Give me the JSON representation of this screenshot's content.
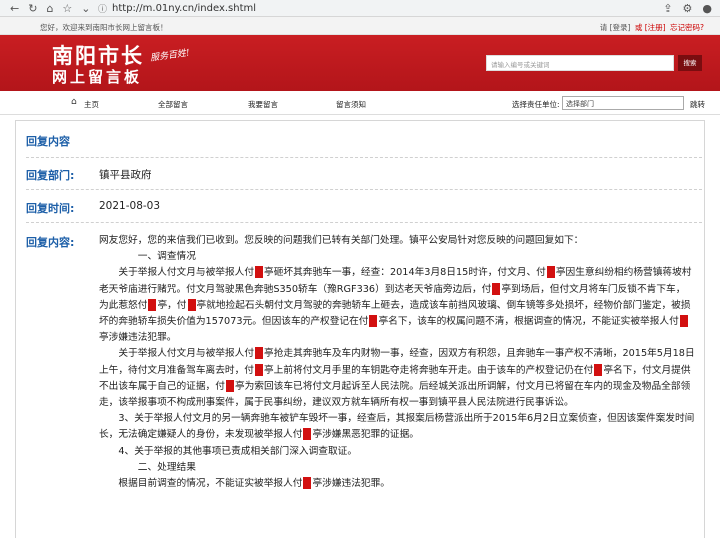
{
  "browser": {
    "url": "http://m.01ny.cn/index.shtml"
  },
  "topbar": {
    "welcome": "您好，欢迎来到南阳市长网上留言板！",
    "login": "请 [登录]",
    "register": "或 [注册]",
    "forgot": "忘记密码?"
  },
  "header": {
    "title": "南阳市长",
    "subtitle": "网上留言板",
    "slogan": "服务百姓!",
    "search_placeholder": "请输入编号或关键词",
    "search_button": "搜索"
  },
  "nav": {
    "items": [
      "主页",
      "全部留言",
      "我要留言",
      "留言须知"
    ],
    "department_label": "选择责任单位:",
    "department_selected": "选择部门",
    "jump": "跳转"
  },
  "reply": {
    "section_title": "回复内容",
    "dept_label": "回复部门:",
    "dept_value": "镇平县政府",
    "time_label": "回复时间:",
    "time_value": "2021-08-03",
    "content_label": "回复内容:",
    "paragraphs": [
      "网友您好，您的来信我们已收到。您反映的问题我们已转有关部门处理。镇平公安局针对您反映的问题回复如下：",
      "一、调查情况",
      "关于举报人付文月与被举报人付█亭砸坏其奔驰车一事，经查：2014年3月8日15时许，付文月、付█亭因生意纠纷相约杨营镇蒋坡村老天爷庙进行赌咒。付文月驾驶黑色奔驰S350轿车（豫RGF336）到达老天爷庙旁边后，付█亭到场后，但付文月将车门反锁不肯下车，为此惹怒付█亭，付█亭就地捡起石头朝付文月驾驶的奔驰轿车上砸去，造成该车前挡风玻璃、倒车镜等多处损坏，经物价部门鉴定，被损坏的奔驰轿车损失价值为157073元。但因该车的产权登记在付█亭名下，该车的权属问题不清，根据调查的情况，不能证实被举报人付█亭涉嫌违法犯罪。",
      "关于举报人付文月与被举报人付█亭抢走其奔驰车及车内财物一事，经查，因双方有积怨，且奔驰车一事产权不清晰，2015年5月18日上午，待付文月准备驾车离去时，付█亭上前将付文月手里的车钥匙夺走将奔驰车开走。由于该车的产权登记仍在付█亭名下，付文月提供不出该车属于自己的证据，付█亭为索回该车已将付文月起诉至人民法院。后经城关派出所调解，付文月已将留在车内的现金及物品全部领走，该举报事项不构成刑事案件，属于民事纠纷，建议双方就车辆所有权一事到镇平县人民法院进行民事诉讼。",
      "3、关于举报人付文月的另一辆奔驰车被铲车毁坏一事，经查后，其报案后杨营派出所于2015年6月2日立案侦查，但因该案件案发时间长，无法确定嫌疑人的身份，未发现被举报人付█亭涉嫌黑恶犯罪的证据。",
      "4、关于举报的其他事项已责成相关部门深入调查取证。",
      "二、处理结果",
      "根据目前调查的情况，不能证实被举报人付█亭涉嫌违法犯罪。"
    ]
  }
}
